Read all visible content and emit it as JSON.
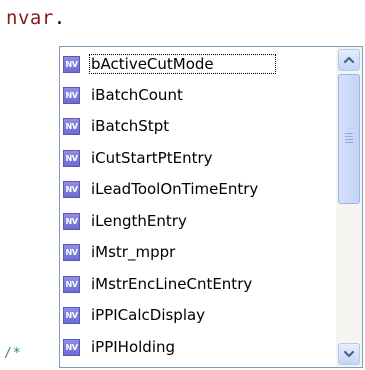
{
  "editor": {
    "typed_text": "nvar",
    "dot": ".",
    "comment_marker": "/*"
  },
  "completion_popup": {
    "item_badge_icon": "network-variable-icon",
    "item_badge_text": "NV",
    "selected_index": 0,
    "items": [
      {
        "label": "bActiveCutMode"
      },
      {
        "label": "iBatchCount"
      },
      {
        "label": "iBatchStpt"
      },
      {
        "label": "iCutStartPtEntry"
      },
      {
        "label": "iLeadToolOnTimeEntry"
      },
      {
        "label": "iLengthEntry"
      },
      {
        "label": "iMstr_mppr"
      },
      {
        "label": "iMstrEncLineCntEntry"
      },
      {
        "label": "iPPICalcDisplay"
      },
      {
        "label": "iPPIHolding"
      }
    ],
    "scrollbar": {
      "up_icon": "scroll-up-arrow-icon",
      "down_icon": "scroll-down-arrow-icon",
      "thumb_icon": "scroll-thumb-grip-icon"
    }
  },
  "colors": {
    "keyword": "#8b1a1a",
    "comment": "#2e8b57",
    "badge": "#7a7adc",
    "popup_border": "#7f9db9"
  }
}
